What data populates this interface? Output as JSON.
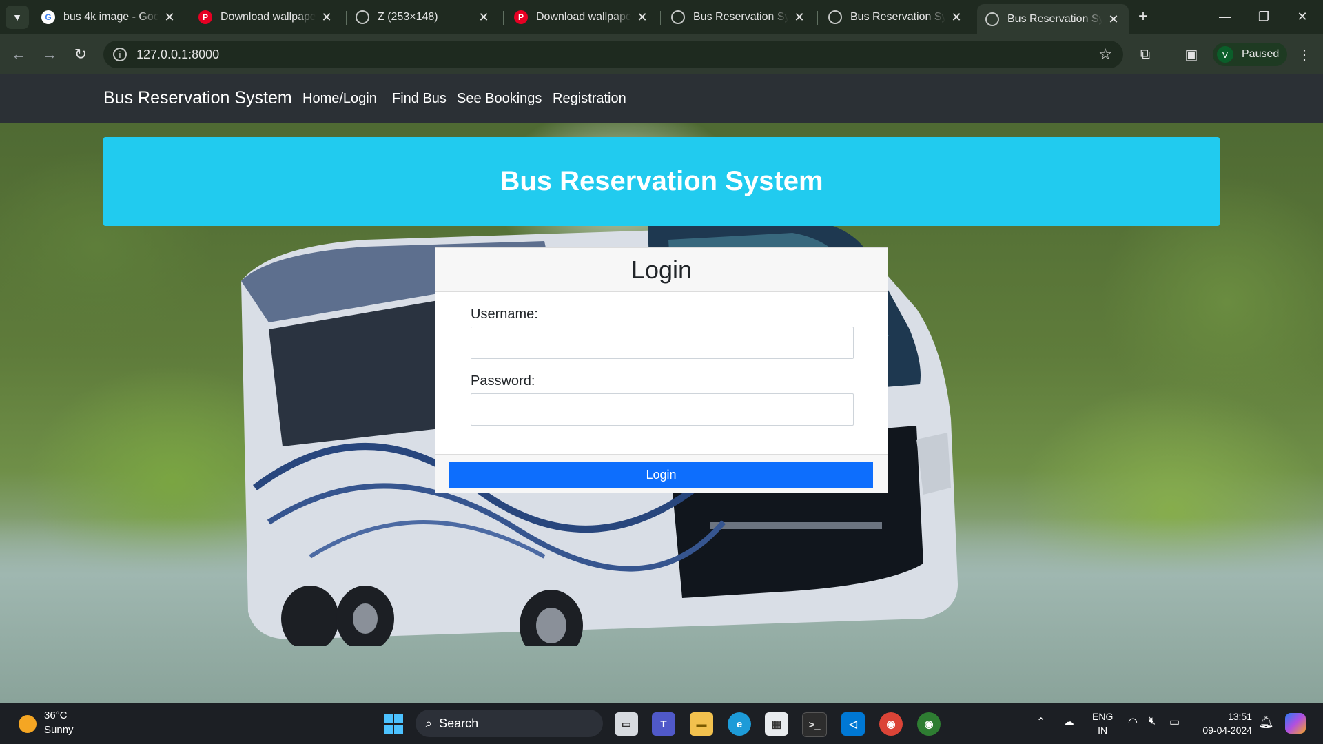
{
  "browser": {
    "tabs": [
      {
        "title": "bus 4k image - Google Search",
        "favicon": "google-icon",
        "active": false
      },
      {
        "title": "Download wallpapers",
        "favicon": "pinterest-icon",
        "active": false
      },
      {
        "title": "Z (253×148)",
        "favicon": "globe-icon",
        "active": false
      },
      {
        "title": "Download wallpapers",
        "favicon": "pinterest-icon",
        "active": false
      },
      {
        "title": "Bus Reservation System",
        "favicon": "globe-icon",
        "active": false
      },
      {
        "title": "Bus Reservation System",
        "favicon": "globe-icon",
        "active": false
      },
      {
        "title": "Bus Reservation System",
        "favicon": "globe-icon",
        "active": true
      }
    ],
    "url": "127.0.0.1:8000",
    "profile": {
      "initial": "V",
      "status": "Paused"
    }
  },
  "navbar": {
    "brand": "Bus Reservation System",
    "links": [
      "Home/Login",
      "Find Bus",
      "See Bookings",
      "Registration"
    ]
  },
  "hero": {
    "title": "Bus Reservation System"
  },
  "login_form": {
    "title": "Login",
    "username_label": "Username:",
    "username_value": "",
    "password_label": "Password:",
    "password_value": "",
    "submit_label": "Login"
  },
  "taskbar": {
    "weather": {
      "temp": "36°C",
      "desc": "Sunny"
    },
    "search_label": "Search",
    "language": {
      "line1": "ENG",
      "line2": "IN"
    },
    "clock": {
      "time": "13:51",
      "date": "09-04-2024"
    }
  },
  "colors": {
    "hero": "#21cbef",
    "navbar": "#2b3035",
    "primary_button": "#0d6efd",
    "browser_frame": "#2f3a30"
  }
}
